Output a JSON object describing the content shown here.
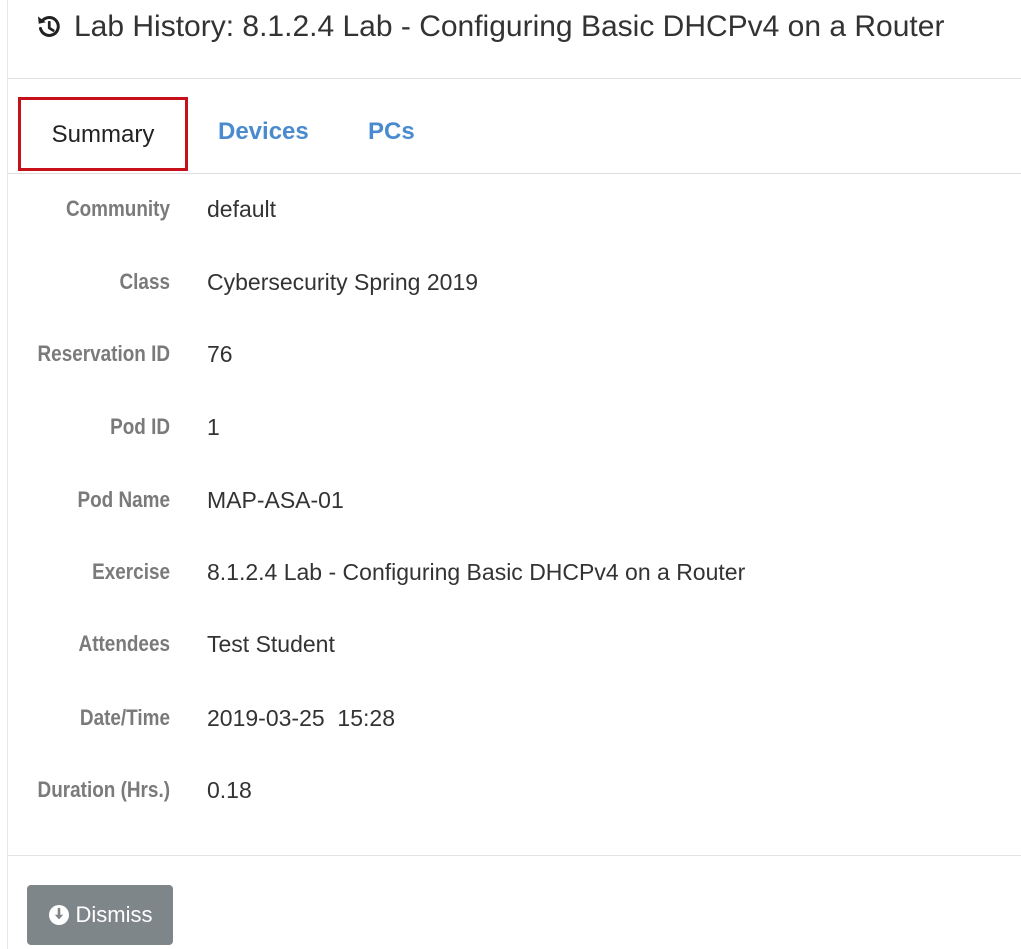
{
  "header": {
    "title": "Lab History: 8.1.2.4 Lab - Configuring Basic DHCPv4 on a Router",
    "icon": "history-icon"
  },
  "tabs": [
    {
      "label": "Summary",
      "active": true
    },
    {
      "label": "Devices",
      "active": false
    },
    {
      "label": "PCs",
      "active": false
    }
  ],
  "details": [
    {
      "label": "Community",
      "value": "default"
    },
    {
      "label": "Class",
      "value": "Cybersecurity Spring 2019"
    },
    {
      "label": "Reservation ID",
      "value": "76"
    },
    {
      "label": "Pod ID",
      "value": "1"
    },
    {
      "label": "Pod Name",
      "value": "MAP-ASA-01"
    },
    {
      "label": "Exercise",
      "value": "8.1.2.4 Lab - Configuring Basic DHCPv4 on a Router"
    },
    {
      "label": "Attendees",
      "value": "Test Student"
    },
    {
      "label": "Date/Time",
      "value": "2019-03-25  15:28"
    },
    {
      "label": "Duration (Hrs.)",
      "value": "0.18"
    }
  ],
  "footer": {
    "dismiss_label": "Dismiss",
    "dismiss_icon": "arrow-circle-down-icon"
  },
  "colors": {
    "active_tab_border": "#c7111a",
    "tab_link": "#4a8bd0",
    "label": "#7a7a7a",
    "button_bg": "#7f8689"
  }
}
